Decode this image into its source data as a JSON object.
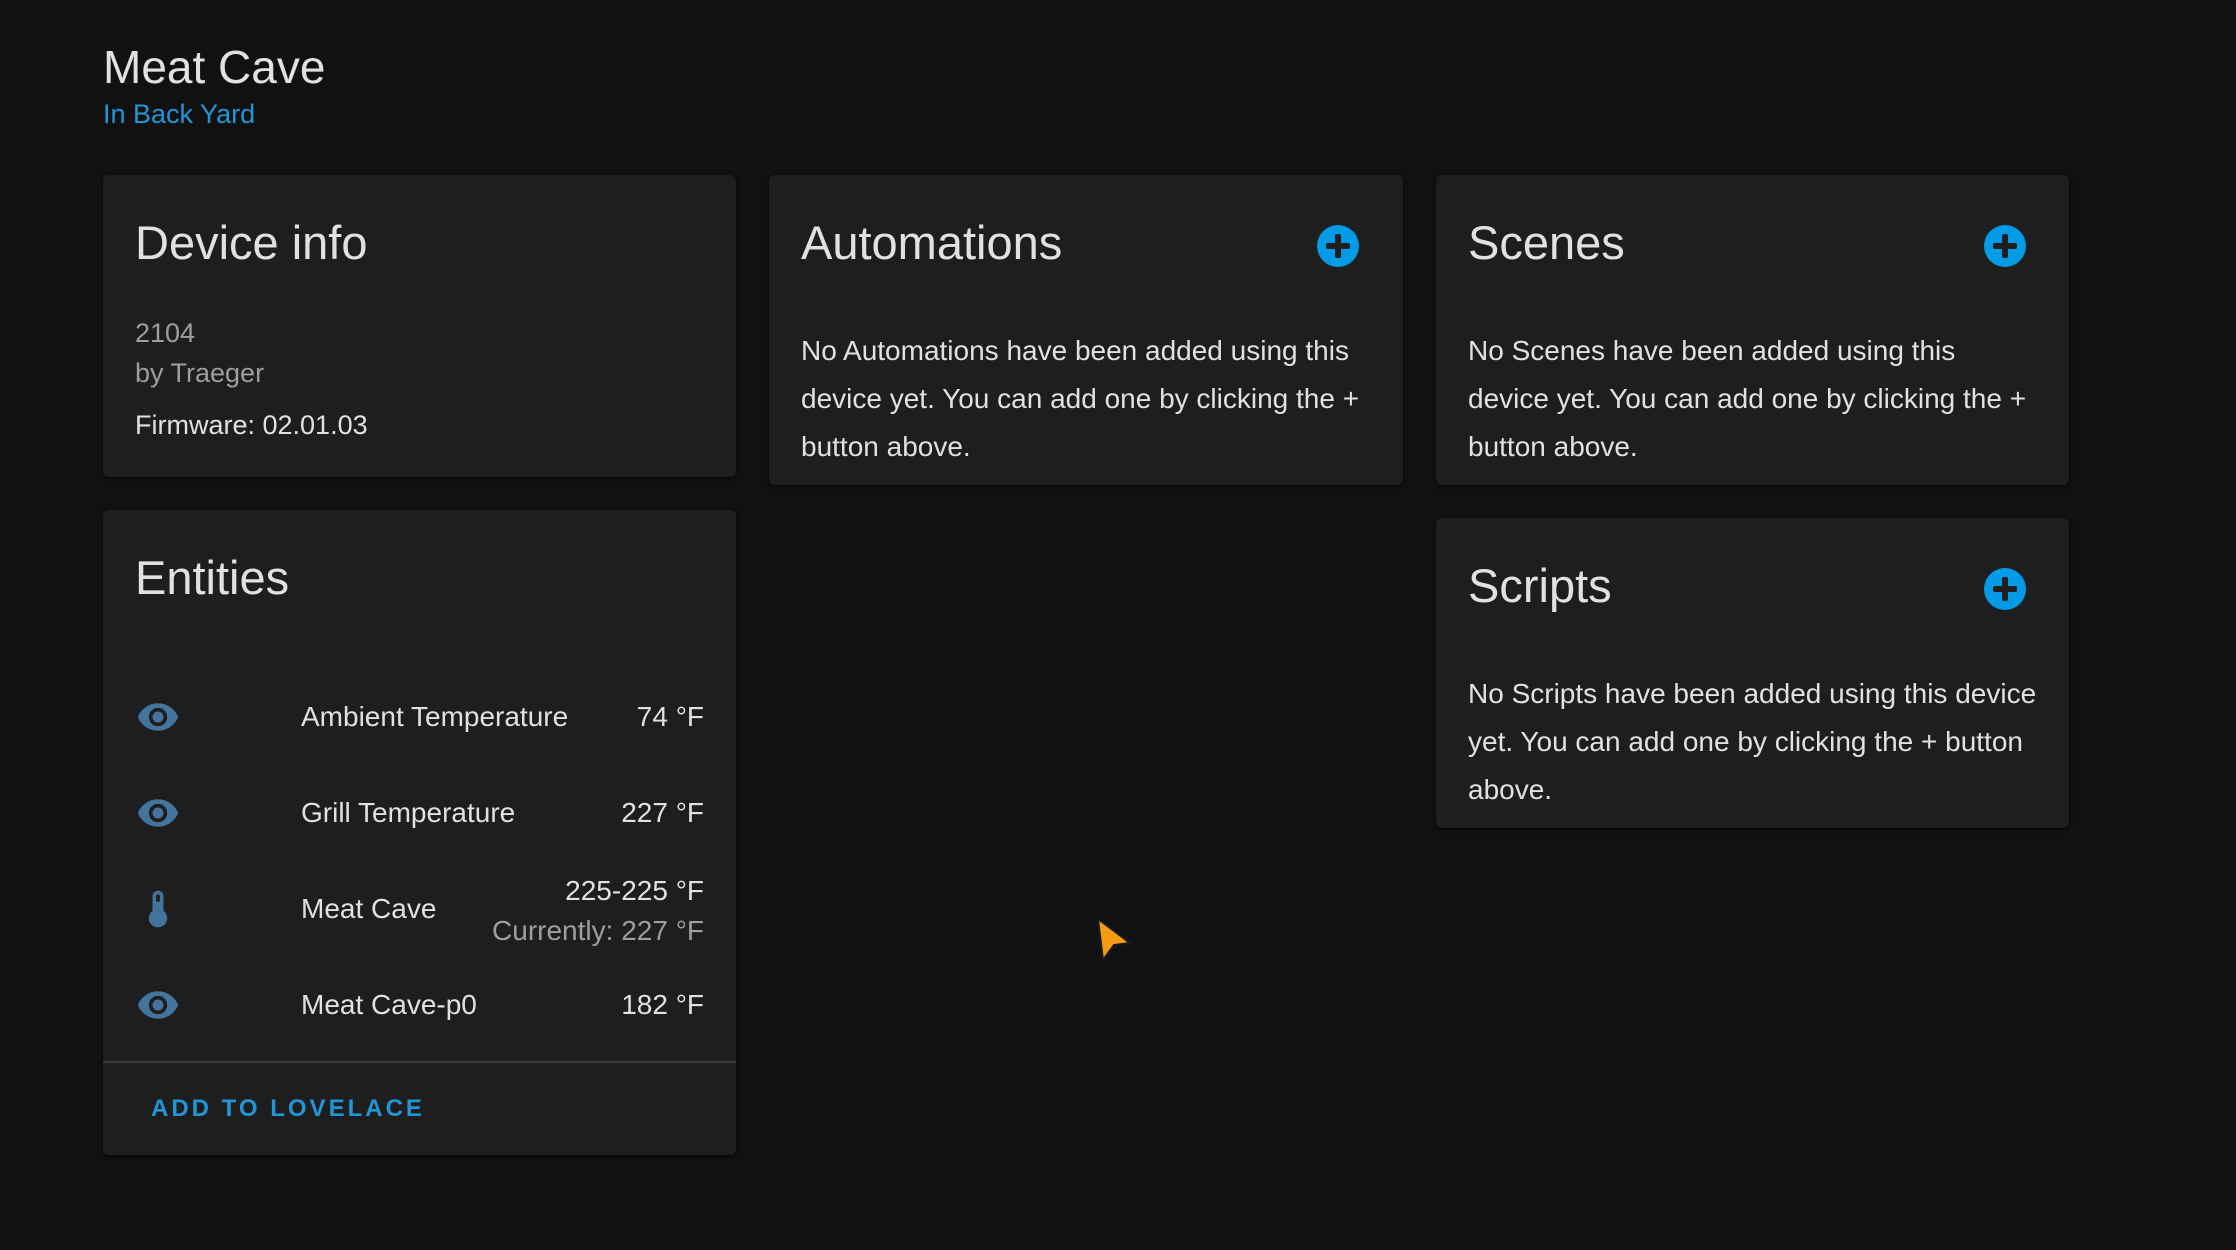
{
  "device": {
    "name": "Meat Cave",
    "area": "In Back Yard"
  },
  "device_info": {
    "title": "Device info",
    "model": "2104",
    "manufacturer": "by Traeger",
    "firmware": "Firmware: 02.01.03"
  },
  "entities": {
    "title": "Entities",
    "items": [
      {
        "icon": "eye-icon",
        "name": "Ambient Temperature",
        "value": "74 °F"
      },
      {
        "icon": "eye-icon",
        "name": "Grill Temperature",
        "value": "227 °F"
      },
      {
        "icon": "thermometer-icon",
        "name": "Meat Cave",
        "value": "225-225 °F",
        "secondary": "Currently: 227 °F"
      },
      {
        "icon": "eye-icon",
        "name": "Meat Cave-p0",
        "value": "182 °F"
      }
    ],
    "action": "ADD TO LOVELACE"
  },
  "automations": {
    "title": "Automations",
    "empty_text": "No Automations have been added using this device yet. You can add one by clicking the + button above."
  },
  "scenes": {
    "title": "Scenes",
    "empty_text": "No Scenes have been added using this device yet. You can add one by clicking the + button above."
  },
  "scripts": {
    "title": "Scripts",
    "empty_text": "No Scripts have been added using this device yet. You can add one by clicking the + button above."
  },
  "colors": {
    "background": "#111111",
    "card": "#1e1e1e",
    "accent": "#039be5",
    "link": "#2196d6",
    "icon": "#44739e",
    "cursor": "#f39c12"
  }
}
